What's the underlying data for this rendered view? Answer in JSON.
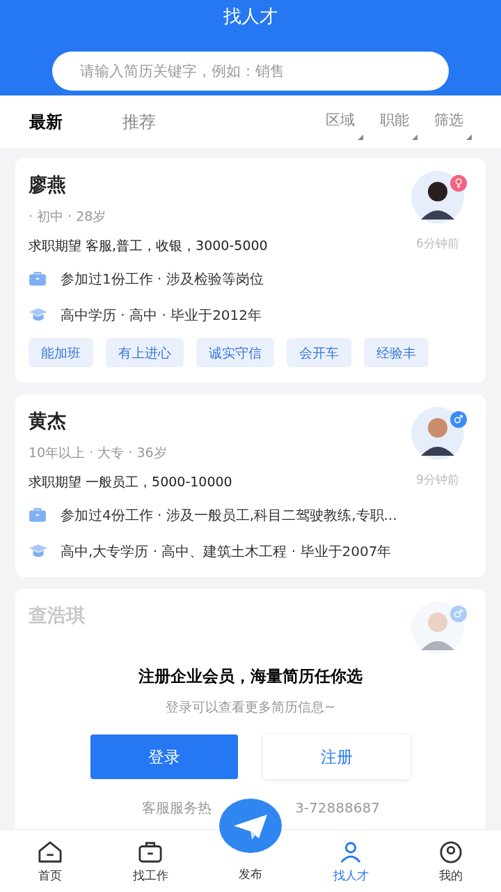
{
  "header": {
    "title": "找人才",
    "search": {
      "placeholder": "请输入简历关键字，例如：销售"
    }
  },
  "tabs": [
    {
      "label": "最新",
      "selected": true
    },
    {
      "label": "推荐",
      "selected": false
    }
  ],
  "filters": [
    {
      "label": "区域"
    },
    {
      "label": "职能"
    },
    {
      "label": "筛选"
    }
  ],
  "resumes": [
    {
      "name": "廖燕",
      "gender": "♀",
      "color": "#f2647e",
      "meta": "· 初中 · 28岁",
      "expectation": "求职期望 客服,普工，收银，3000-5000",
      "time": "6分钟前",
      "experience": "参加过1份工作 · 涉及检验等岗位",
      "education": "高中学历 · 高中 · 毕业于2012年",
      "tags": [
        "能加班",
        "有上进心",
        "诚实守信",
        "会开车",
        "经验丰"
      ]
    },
    {
      "name": "黄杰",
      "gender": "♂",
      "color": "#3b8cf5",
      "meta": "10年以上 · 大专 · 36岁",
      "expectation": "求职期望 一般员工，5000-10000",
      "time": "9分钟前",
      "experience": "参加过4份工作 · 涉及一般员工,科目二驾驶教练,专职...",
      "education": "高中,大专学历 · 高中、建筑土木工程 · 毕业于2007年"
    }
  ],
  "locked_resume": {
    "name": "查浩琪",
    "gender": "♂",
    "color": "#a9ccf7"
  },
  "login_prompt": {
    "title": "注册企业会员，海量简历任你选",
    "subtitle": "登录可以查看更多简历信息~",
    "login_button": "登录",
    "register_button": "注册",
    "hotline_start": "客服服务热",
    "hotline_end": "3-72888687"
  },
  "bottom_nav": [
    {
      "label": "首页",
      "kind": "home",
      "selected": false
    },
    {
      "label": "找工作",
      "kind": "jobs",
      "selected": false
    },
    {
      "label": "发布",
      "kind": "publish",
      "selected": false
    },
    {
      "label": "找人才",
      "kind": "talent",
      "selected": true
    },
    {
      "label": "我的",
      "kind": "me",
      "selected": false
    }
  ]
}
